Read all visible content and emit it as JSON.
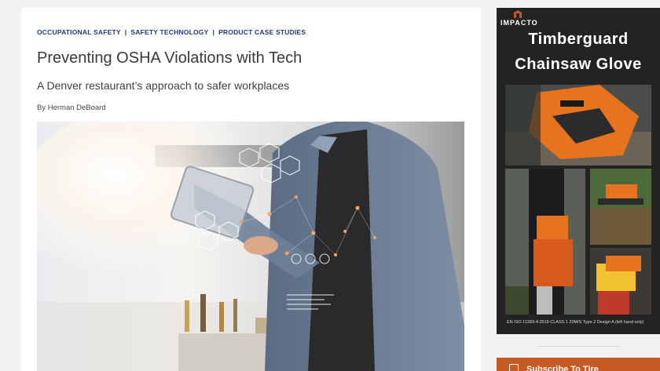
{
  "article": {
    "categories": [
      "OCCUPATIONAL SAFETY",
      "SAFETY TECHNOLOGY",
      "PRODUCT CASE STUDIES"
    ],
    "title": "Preventing OSHA Violations with Tech",
    "subtitle": "A Denver restaurant’s approach to safer workplaces",
    "byline_prefix": "By ",
    "author": "Herman DeBoard"
  },
  "ad": {
    "brand": "IMPACTO",
    "title_line1": "Timberguard",
    "title_line2": "Chainsaw Glove",
    "footnote": "EN ISO 11393-4:2019 CLASS 1 20M/S Type 2 Design A (left hand only)"
  },
  "subscribe": {
    "label": "Subscribe To Tire"
  },
  "colors": {
    "breadcrumb": "#243a73",
    "title": "#3a3a3a",
    "ad_bg": "#232323",
    "accent": "#c65a23",
    "glove_orange": "#e8731f"
  },
  "icons": [
    "impacto-logo-icon",
    "subscribe-mail-icon"
  ]
}
